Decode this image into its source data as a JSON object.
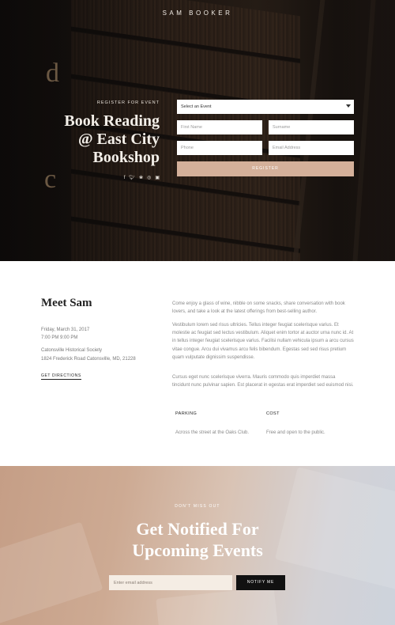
{
  "header": {
    "brand": "SAM BOOKER"
  },
  "hero": {
    "label": "REGISTER FOR EVENT",
    "title_lines": [
      "Book Reading",
      "@ East City",
      "Bookshop"
    ],
    "letters": [
      "d",
      "c"
    ],
    "social_icons": [
      "facebook-icon",
      "twitter-icon",
      "pinterest-icon",
      "instagram-icon",
      "linkedin-icon"
    ]
  },
  "form": {
    "select_value": "Select an Event",
    "first_name_placeholder": "First Name",
    "surname_placeholder": "Surname",
    "phone_placeholder": "Phone",
    "email_placeholder": "Email Address",
    "register_label": "REGISTER"
  },
  "details": {
    "title": "Meet Sam",
    "date": "Friday, March 31, 2017",
    "time": "7:00 PM 9:00 PM",
    "venue": "Catonsville Historical Society",
    "address": "1824 Frederick Road Catonsville, MD, 21228",
    "directions_label": "GET DIRECTIONS",
    "paragraphs": [
      "Come enjoy a glass of wine, nibble on some snacks, share conversation with book lovers, and take a look at the latest offerings from best-selling author.",
      "Vestibulum lorem sed risus ultricies. Tellus integer feugiat scelerisque varius. Et molestie ac feugiat sed lectus vestibulum. Aliquet enim tortor at auctor urna nunc id. At in tellus integer feugiat scelerisque varius. Facilisi nullam vehicula ipsum a arcu cursus vitae congue. Arcu dui vivamus arcu felis bibendum. Egestas sed sed risus pretium quam vulputate dignissim suspendisse.",
      "Cursus eget nunc scelerisque viverra. Mauris commodo quis imperdiet massa tincidunt nunc pulvinar sapien. Est placerat in egestas erat imperdiet sed euismod nisi."
    ],
    "parking_label": "PARKING",
    "parking_value": "Across the street at the Oaks Club.",
    "cost_label": "COST",
    "cost_value": "Free and open to the public."
  },
  "notify": {
    "label": "DON'T MISS OUT",
    "title_lines": [
      "Get Notified For",
      "Upcoming Events"
    ],
    "email_placeholder": "Enter email address",
    "button_label": "NOTIFY ME"
  },
  "colors": {
    "accent": "#d4b09a",
    "dark": "#111111",
    "hero_bg": "#1b1512"
  }
}
